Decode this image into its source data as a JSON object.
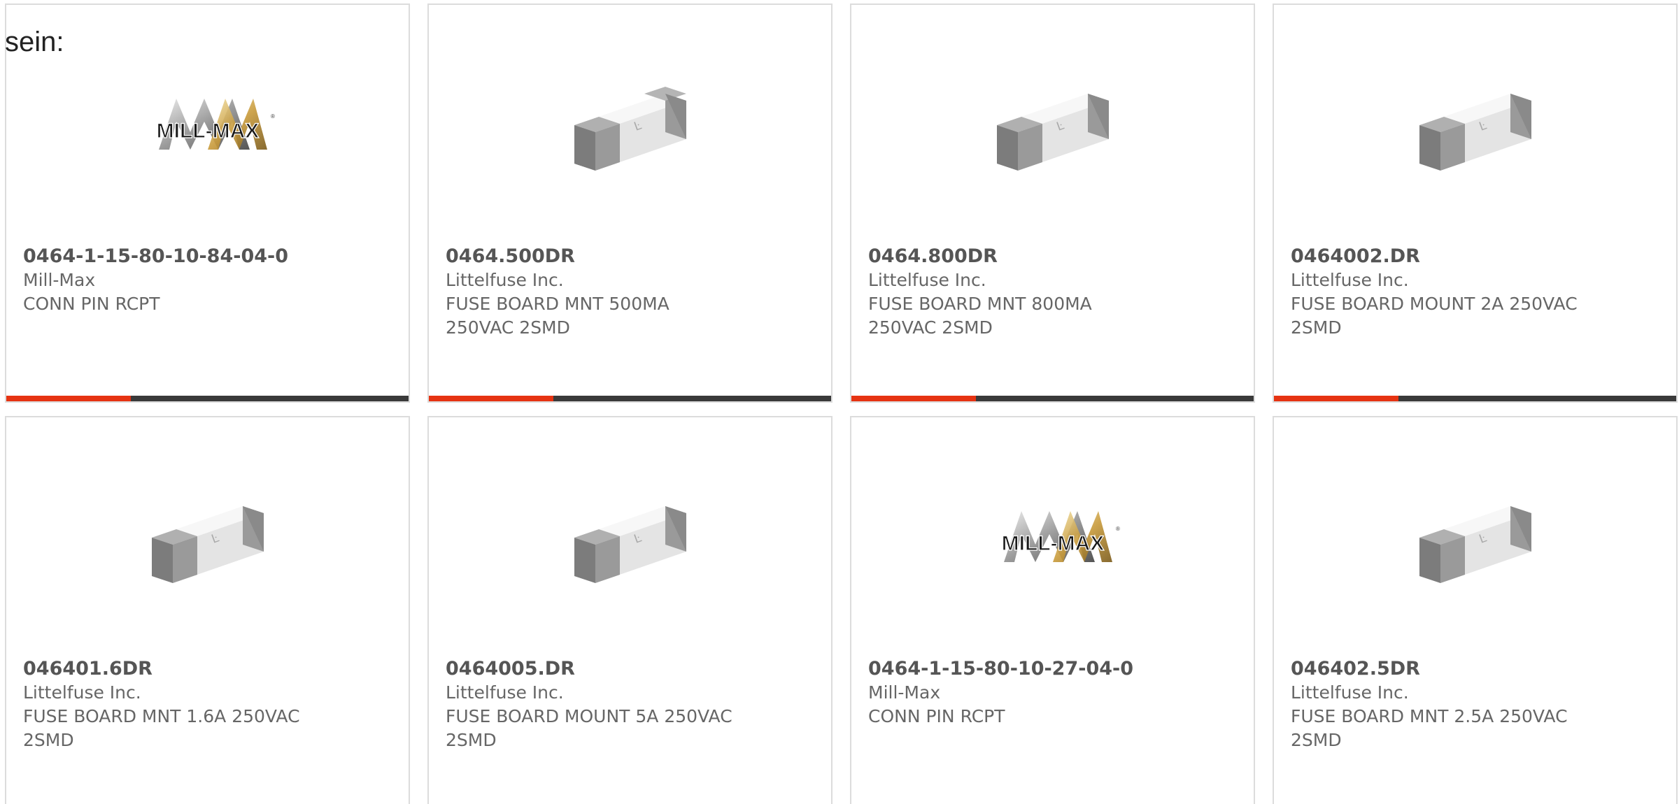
{
  "intro_text": "sein:",
  "colors": {
    "accent": "#e63312",
    "track": "#3a3a3a",
    "border": "#dcdcdc"
  },
  "products": [
    {
      "part": "0464-1-15-80-10-84-04-0",
      "maker": "Mill-Max",
      "desc": "CONN PIN RCPT",
      "image": "mill-max-logo",
      "progress": 0.31
    },
    {
      "part": "0464.500DR",
      "maker": "Littelfuse Inc.",
      "desc": "FUSE BOARD MNT 500MA 250VAC 2SMD",
      "image": "smd-fuse",
      "progress": 0.31
    },
    {
      "part": "0464.800DR",
      "maker": "Littelfuse Inc.",
      "desc": "FUSE BOARD MNT 800MA 250VAC 2SMD",
      "image": "smd-fuse",
      "progress": 0.31
    },
    {
      "part": "0464002.DR",
      "maker": "Littelfuse Inc.",
      "desc": "FUSE BOARD MOUNT 2A 250VAC 2SMD",
      "image": "smd-fuse",
      "progress": 0.31
    },
    {
      "part": "046401.6DR",
      "maker": "Littelfuse Inc.",
      "desc": "FUSE BOARD MNT 1.6A 250VAC 2SMD",
      "image": "smd-fuse"
    },
    {
      "part": "0464005.DR",
      "maker": "Littelfuse Inc.",
      "desc": "FUSE BOARD MOUNT 5A 250VAC 2SMD",
      "image": "smd-fuse"
    },
    {
      "part": "0464-1-15-80-10-27-04-0",
      "maker": "Mill-Max",
      "desc": "CONN PIN RCPT",
      "image": "mill-max-logo"
    },
    {
      "part": "046402.5DR",
      "maker": "Littelfuse Inc.",
      "desc": "FUSE BOARD MNT 2.5A 250VAC 2SMD",
      "image": "smd-fuse"
    }
  ]
}
